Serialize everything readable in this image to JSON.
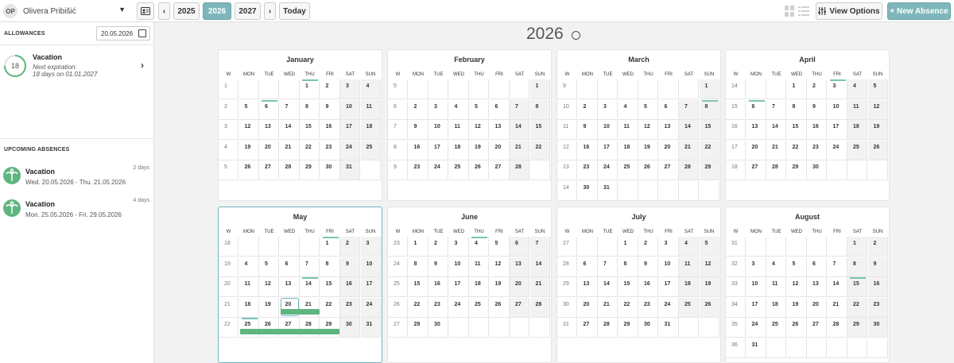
{
  "user": {
    "initials": "OP",
    "name": "Olivera Pribišić"
  },
  "nav": {
    "prev": "‹",
    "next": "›",
    "years": [
      "2025",
      "2026",
      "2027"
    ],
    "active_year": "2026",
    "today": "Today"
  },
  "toolbar": {
    "view_options": "View Options",
    "new_absence": "+ New Absence"
  },
  "allowances": {
    "title": "ALLOWANCES",
    "date": "20.05.2026",
    "item": {
      "number": "18",
      "name": "Vacation",
      "line1": "Next expiration:",
      "line2": "18 days on 01.01.2027"
    }
  },
  "upcoming": {
    "title": "UPCOMING ABSENCES",
    "items": [
      {
        "name": "Vacation",
        "range": "Wed. 20.05.2026 - Thu. 21.05.2026",
        "days": "2 days"
      },
      {
        "name": "Vacation",
        "range": "Mon. 25.05.2026 - Fri. 29.05.2026",
        "days": "4 days"
      }
    ]
  },
  "year_title": "2026",
  "dow_labels": [
    "W",
    "MON",
    "TUE",
    "WED",
    "THU",
    "FRI",
    "SAT",
    "SUN"
  ],
  "months": [
    {
      "name": "January",
      "rows": [
        [
          "1",
          "",
          "",
          "",
          "1",
          "2",
          "3",
          "4"
        ],
        [
          "2",
          "5",
          "6",
          "7",
          "8",
          "9",
          "10",
          "11"
        ],
        [
          "3",
          "12",
          "13",
          "14",
          "15",
          "16",
          "17",
          "18"
        ],
        [
          "4",
          "19",
          "20",
          "21",
          "22",
          "23",
          "24",
          "25"
        ],
        [
          "5",
          "26",
          "27",
          "28",
          "29",
          "30",
          "31",
          ""
        ]
      ],
      "holidays": [
        [
          0,
          4
        ],
        [
          1,
          2
        ]
      ]
    },
    {
      "name": "February",
      "rows": [
        [
          "5",
          "",
          "",
          "",
          "",
          "",
          "",
          "1"
        ],
        [
          "6",
          "2",
          "3",
          "4",
          "5",
          "6",
          "7",
          "8"
        ],
        [
          "7",
          "9",
          "10",
          "11",
          "12",
          "13",
          "14",
          "15"
        ],
        [
          "8",
          "16",
          "17",
          "18",
          "19",
          "20",
          "21",
          "22"
        ],
        [
          "9",
          "23",
          "24",
          "25",
          "26",
          "27",
          "28",
          ""
        ]
      ],
      "holidays": []
    },
    {
      "name": "March",
      "rows": [
        [
          "9",
          "",
          "",
          "",
          "",
          "",
          "",
          "1"
        ],
        [
          "10",
          "2",
          "3",
          "4",
          "5",
          "6",
          "7",
          "8"
        ],
        [
          "11",
          "9",
          "10",
          "11",
          "12",
          "13",
          "14",
          "15"
        ],
        [
          "12",
          "16",
          "17",
          "18",
          "19",
          "20",
          "21",
          "22"
        ],
        [
          "13",
          "23",
          "24",
          "25",
          "26",
          "27",
          "28",
          "29"
        ],
        [
          "14",
          "30",
          "31",
          "",
          "",
          "",
          "",
          ""
        ]
      ],
      "holidays": [
        [
          1,
          7
        ]
      ]
    },
    {
      "name": "April",
      "rows": [
        [
          "14",
          "",
          "",
          "1",
          "2",
          "3",
          "4",
          "5"
        ],
        [
          "15",
          "6",
          "7",
          "8",
          "9",
          "10",
          "11",
          "12"
        ],
        [
          "16",
          "13",
          "14",
          "15",
          "16",
          "17",
          "18",
          "19"
        ],
        [
          "17",
          "20",
          "21",
          "22",
          "23",
          "24",
          "25",
          "26"
        ],
        [
          "18",
          "27",
          "28",
          "29",
          "30",
          "",
          "",
          ""
        ]
      ],
      "holidays": [
        [
          0,
          5
        ],
        [
          1,
          1
        ]
      ]
    },
    {
      "name": "May",
      "rows": [
        [
          "18",
          "",
          "",
          "",
          "",
          "1",
          "2",
          "3"
        ],
        [
          "19",
          "4",
          "5",
          "6",
          "7",
          "8",
          "9",
          "10"
        ],
        [
          "20",
          "11",
          "12",
          "13",
          "14",
          "15",
          "16",
          "17"
        ],
        [
          "21",
          "18",
          "19",
          "20",
          "21",
          "22",
          "23",
          "24"
        ],
        [
          "22",
          "25",
          "26",
          "27",
          "28",
          "29",
          "30",
          "31"
        ]
      ],
      "holidays": [
        [
          0,
          5
        ],
        [
          2,
          4
        ],
        [
          4,
          1
        ]
      ]
    },
    {
      "name": "June",
      "rows": [
        [
          "23",
          "1",
          "2",
          "3",
          "4",
          "5",
          "6",
          "7"
        ],
        [
          "24",
          "8",
          "9",
          "10",
          "11",
          "12",
          "13",
          "14"
        ],
        [
          "25",
          "15",
          "16",
          "17",
          "18",
          "19",
          "20",
          "21"
        ],
        [
          "26",
          "22",
          "23",
          "24",
          "25",
          "26",
          "27",
          "28"
        ],
        [
          "27",
          "29",
          "30",
          "",
          "",
          "",
          "",
          ""
        ]
      ],
      "holidays": [
        [
          0,
          4
        ]
      ]
    },
    {
      "name": "July",
      "rows": [
        [
          "27",
          "",
          "",
          "1",
          "2",
          "3",
          "4",
          "5"
        ],
        [
          "28",
          "6",
          "7",
          "8",
          "9",
          "10",
          "11",
          "12"
        ],
        [
          "29",
          "13",
          "14",
          "15",
          "16",
          "17",
          "18",
          "19"
        ],
        [
          "30",
          "20",
          "21",
          "22",
          "23",
          "24",
          "25",
          "26"
        ],
        [
          "31",
          "27",
          "28",
          "29",
          "30",
          "31",
          "",
          ""
        ]
      ],
      "holidays": []
    },
    {
      "name": "August",
      "rows": [
        [
          "31",
          "",
          "",
          "",
          "",
          "",
          "1",
          "2"
        ],
        [
          "32",
          "3",
          "4",
          "5",
          "6",
          "7",
          "8",
          "9"
        ],
        [
          "33",
          "10",
          "11",
          "12",
          "13",
          "14",
          "15",
          "16"
        ],
        [
          "34",
          "17",
          "18",
          "19",
          "20",
          "21",
          "22",
          "23"
        ],
        [
          "35",
          "24",
          "25",
          "26",
          "27",
          "28",
          "29",
          "30"
        ],
        [
          "36",
          "31",
          "",
          "",
          "",
          "",
          "",
          ""
        ]
      ],
      "holidays": [
        [
          2,
          6
        ]
      ]
    }
  ],
  "today_cell": {
    "month": 4,
    "row": 3,
    "col": 3
  },
  "absences": [
    {
      "month": 4,
      "row": 3,
      "from": 3,
      "to": 4
    },
    {
      "month": 4,
      "row": 4,
      "from": 1,
      "to": 5
    }
  ]
}
